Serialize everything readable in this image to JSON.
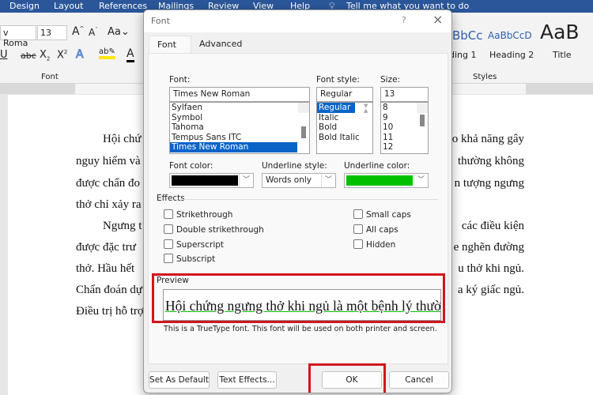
{
  "ribbon": {
    "tabs": [
      "Design",
      "Layout",
      "References",
      "Mailings",
      "Review",
      "View",
      "Help"
    ],
    "tell_me": "Tell me what you want to do",
    "font_name": "v Roma",
    "font_size": "13",
    "font_group_label": "Font",
    "styles_group_label": "Styles",
    "styles": [
      {
        "preview": "BbCc",
        "label": "ding 1"
      },
      {
        "preview": "AaBbCcD",
        "label": "Heading 2"
      },
      {
        "preview": "AaB",
        "label": "Title"
      }
    ]
  },
  "document": {
    "left_fragments": [
      "Hội chứ",
      "nguy hiểm và",
      "được chẩn đo",
      "thở chỉ xảy ra",
      "Ngưng t",
      "được đặc trư",
      "thở. Hầu hết",
      "Chẩn đoán dự",
      "Điều trị hỗ trợ"
    ],
    "right_fragments": [
      "o khả năng gây",
      "thường không",
      "n tượng ngưng",
      "",
      "các điều kiện",
      "e nghẽn đường",
      "u thở khi ngủ.",
      "a ký giấc ngủ.",
      ""
    ]
  },
  "dialog": {
    "title": "Font",
    "help": "?",
    "close": "×",
    "tabs": [
      "Font",
      "Advanced"
    ],
    "font_label": "Font:",
    "font_value": "Times New Roman",
    "font_list": [
      "Sylfaen",
      "Symbol",
      "Tahoma",
      "Tempus Sans ITC",
      "Times New Roman"
    ],
    "font_selected": "Times New Roman",
    "style_label": "Font style:",
    "style_value": "Regular",
    "style_list": [
      "Regular",
      "Italic",
      "Bold",
      "Bold Italic"
    ],
    "style_selected": "Regular",
    "size_label": "Size:",
    "size_value": "13",
    "size_list": [
      "8",
      "9",
      "10",
      "11",
      "12"
    ],
    "font_color_label": "Font color:",
    "font_color": "#000000",
    "underline_style_label": "Underline style:",
    "underline_style": "Words only",
    "underline_color_label": "Underline color:",
    "underline_color": "#00c000",
    "effects_label": "Effects",
    "effects_left": [
      "Strikethrough",
      "Double strikethrough",
      "Superscript",
      "Subscript"
    ],
    "effects_right": [
      "Small caps",
      "All caps",
      "Hidden"
    ],
    "preview_label": "Preview",
    "preview_text": "Hội chứng ngưng thở khi ngủ là một bệnh lý thường gặp",
    "note": "This is a TrueType font. This font will be used on both printer and screen.",
    "buttons": {
      "set_default": "Set As Default",
      "text_effects": "Text Effects...",
      "ok": "OK",
      "cancel": "Cancel"
    }
  },
  "highlight_color": "#d0161e"
}
